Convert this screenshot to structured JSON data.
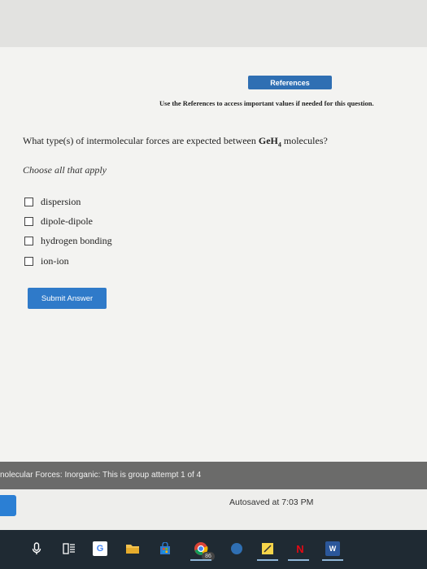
{
  "references": {
    "button_label": "References",
    "note": "Use the References to access important values if needed for this question."
  },
  "question": {
    "prefix": "What type(s) of intermolecular forces are expected between ",
    "formula_main": "GeH",
    "formula_sub": "4",
    "suffix": " molecules?"
  },
  "instruction": "Choose all that apply",
  "options": [
    {
      "label": "dispersion",
      "checked": false
    },
    {
      "label": "dipole-dipole",
      "checked": false
    },
    {
      "label": "hydrogen bonding",
      "checked": false
    },
    {
      "label": "ion-ion",
      "checked": false
    }
  ],
  "submit": {
    "label": "Submit Answer"
  },
  "status_bar": {
    "text": "nolecular Forces: Inorganic: This is group attempt 1 of 4"
  },
  "autosave": {
    "text": "Autosaved at 7:03 PM"
  },
  "taskbar": {
    "badge": "86",
    "icons": [
      "microphone-icon",
      "task-view-icon",
      "google-icon",
      "file-explorer-icon",
      "store-icon",
      "chrome-icon",
      "sticky-notes-icon",
      "netflix-icon",
      "word-icon"
    ]
  },
  "colors": {
    "accent": "#2f6fb3",
    "submit": "#2f7ac9",
    "status_bar": "#6b6b6a",
    "taskbar": "#1f2a33"
  }
}
